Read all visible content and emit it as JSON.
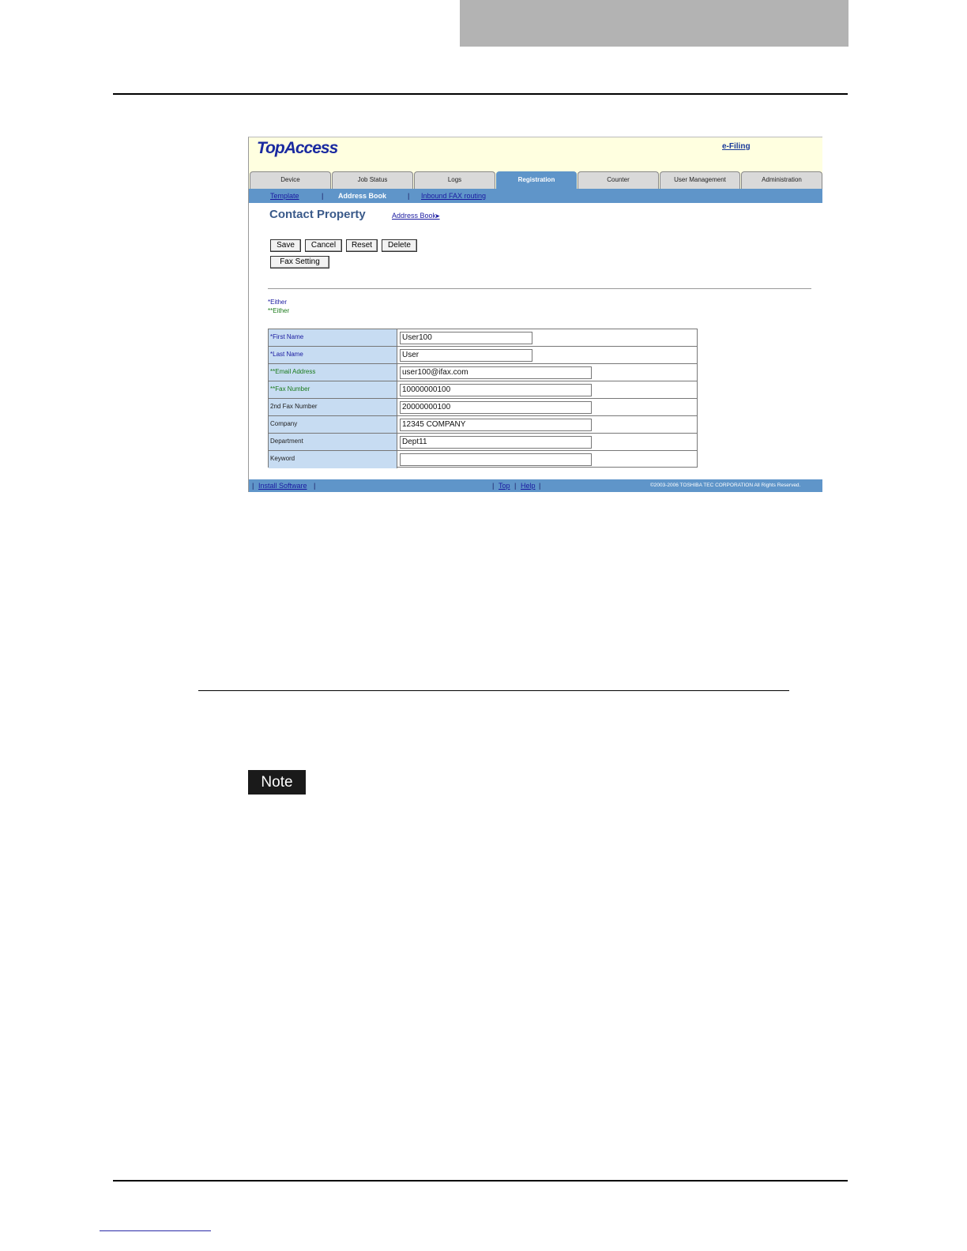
{
  "page": {
    "note_label": "Note"
  },
  "app": {
    "logo": "TopAccess",
    "efiling_link": "e-Filing"
  },
  "tabs": [
    {
      "label": "Device"
    },
    {
      "label": "Job Status"
    },
    {
      "label": "Logs"
    },
    {
      "label": "Registration"
    },
    {
      "label": "Counter"
    },
    {
      "label": "User Management"
    },
    {
      "label": "Administration"
    }
  ],
  "active_tab": "Registration",
  "subnav": {
    "template": "Template",
    "sep": "|",
    "address_book": "Address Book",
    "inbound_fax": "Inbound FAX routing"
  },
  "main": {
    "title": "Contact Property",
    "address_book_link": "Address Book▸",
    "buttons": {
      "save": "Save",
      "cancel": "Cancel",
      "reset": "Reset",
      "delete": "Delete",
      "fax_setting": "Fax Setting"
    },
    "either_single": "*Either",
    "either_double": "**Either"
  },
  "form": {
    "rows": [
      {
        "label": "*First Name",
        "value": "User100"
      },
      {
        "label": "*Last Name",
        "value": "User"
      },
      {
        "label": "**Email Address",
        "value": "user100@ifax.com"
      },
      {
        "label": "**Fax Number",
        "value": "10000000100"
      },
      {
        "label": "2nd Fax Number",
        "value": "20000000100"
      },
      {
        "label": "Company",
        "value": "12345 COMPANY"
      },
      {
        "label": "Department",
        "value": "Dept11"
      },
      {
        "label": "Keyword",
        "value": ""
      }
    ]
  },
  "footer": {
    "sep": "|",
    "install_software": "Install Software",
    "top": "Top",
    "help": "Help",
    "copyright": "©2003-2006 TOSHIBA TEC CORPORATION All Rights Reserved."
  }
}
